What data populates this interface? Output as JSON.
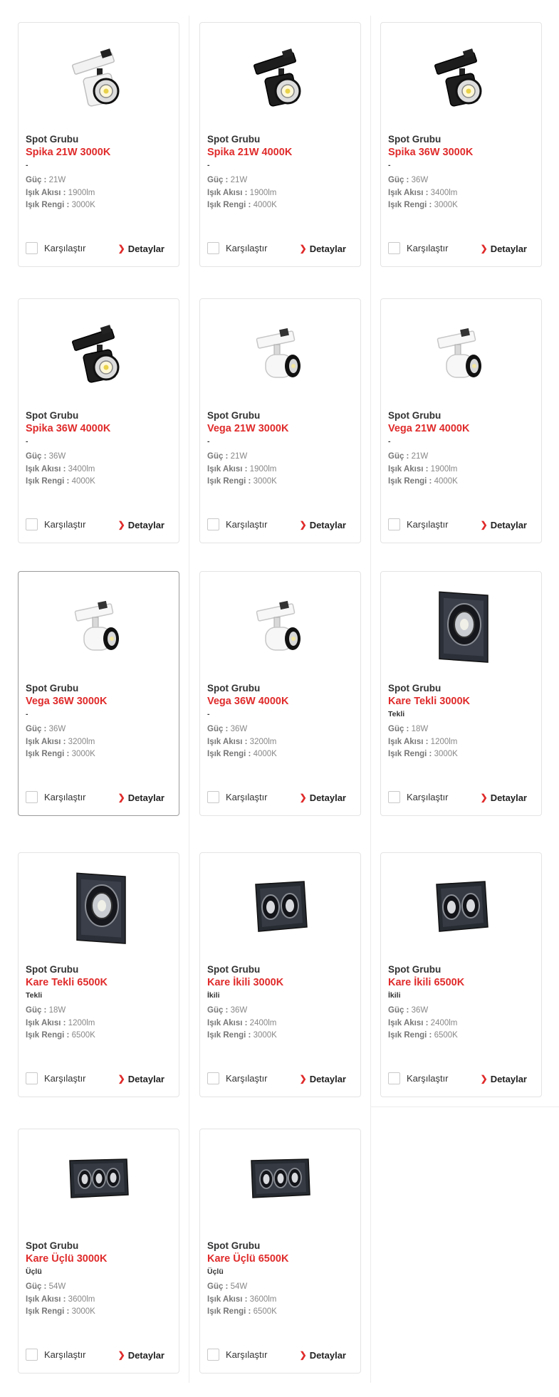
{
  "colors": {
    "accent": "#e02b2b",
    "border": "#e4e4e4",
    "highlight_border": "#9a9a9a"
  },
  "labels": {
    "power": "Güç :",
    "flux": "Işık Akısı :",
    "color": "Işık Rengi :",
    "compare": "Karşılaştır",
    "details": "Detaylar"
  },
  "products": [
    {
      "group": "Spot Grubu",
      "name": "Spika 21W 3000K",
      "sub": "-",
      "power": "21W",
      "flux": "1900lm",
      "color": "3000K",
      "image": "spika-white"
    },
    {
      "group": "Spot Grubu",
      "name": "Spika 21W 4000K",
      "sub": "-",
      "power": "21W",
      "flux": "1900lm",
      "color": "4000K",
      "image": "spika-black"
    },
    {
      "group": "Spot Grubu",
      "name": "Spika 36W 3000K",
      "sub": "-",
      "power": "36W",
      "flux": "3400lm",
      "color": "3000K",
      "image": "spika-black"
    },
    {
      "group": "Spot Grubu",
      "name": "Spika 36W 4000K",
      "sub": "-",
      "power": "36W",
      "flux": "3400lm",
      "color": "4000K",
      "image": "spika-black"
    },
    {
      "group": "Spot Grubu",
      "name": "Vega 21W 3000K",
      "sub": "-",
      "power": "21W",
      "flux": "1900lm",
      "color": "3000K",
      "image": "vega-white"
    },
    {
      "group": "Spot Grubu",
      "name": "Vega 21W 4000K",
      "sub": "-",
      "power": "21W",
      "flux": "1900lm",
      "color": "4000K",
      "image": "vega-white"
    },
    {
      "group": "Spot Grubu",
      "name": "Vega 36W 3000K",
      "sub": "-",
      "power": "36W",
      "flux": "3200lm",
      "color": "3000K",
      "image": "vega-white"
    },
    {
      "group": "Spot Grubu",
      "name": "Vega 36W 4000K",
      "sub": "-",
      "power": "36W",
      "flux": "3200lm",
      "color": "4000K",
      "image": "vega-white"
    },
    {
      "group": "Spot Grubu",
      "name": "Kare Tekli 3000K",
      "sub": "Tekli",
      "power": "18W",
      "flux": "1200lm",
      "color": "3000K",
      "image": "kare-single"
    },
    {
      "group": "Spot Grubu",
      "name": "Kare Tekli 6500K",
      "sub": "Tekli",
      "power": "18W",
      "flux": "1200lm",
      "color": "6500K",
      "image": "kare-single"
    },
    {
      "group": "Spot Grubu",
      "name": "Kare İkili 3000K",
      "sub": "İkili",
      "power": "36W",
      "flux": "2400lm",
      "color": "3000K",
      "image": "kare-double"
    },
    {
      "group": "Spot Grubu",
      "name": "Kare İkili 6500K",
      "sub": "İkili",
      "power": "36W",
      "flux": "2400lm",
      "color": "6500K",
      "image": "kare-double"
    },
    {
      "group": "Spot Grubu",
      "name": "Kare Üçlü 3000K",
      "sub": "Üçlü",
      "power": "54W",
      "flux": "3600lm",
      "color": "3000K",
      "image": "kare-triple"
    },
    {
      "group": "Spot Grubu",
      "name": "Kare Üçlü 6500K",
      "sub": "Üçlü",
      "power": "54W",
      "flux": "3600lm",
      "color": "6500K",
      "image": "kare-triple"
    }
  ]
}
